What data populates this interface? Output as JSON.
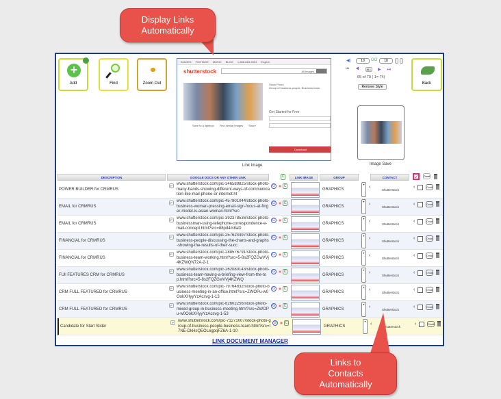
{
  "callouts": {
    "top": "Display Links Automatically",
    "bottom": "Links to Contacts Automatically"
  },
  "toolbar": {
    "add": "Add",
    "find": "Find",
    "zoom_out": "Zoom Out",
    "back": "Back"
  },
  "preview": {
    "tabs": [
      "IMAGES",
      "FOOTAGE",
      "MUSIC",
      "BLOG",
      "1-866-663-3954",
      "English"
    ],
    "logo": "shutterstock",
    "search_filter": "All images",
    "stock_photo": "Stock Photo",
    "description": "Group of business people. Business team.",
    "get_started": "Get Started for Free",
    "download": "Download",
    "actions": [
      "Save to a lightbox",
      "Find similar images",
      "Share"
    ],
    "caption": "Link Image"
  },
  "pager": {
    "per_page_1": "10",
    "per_page_2": "10",
    "all": "ALL",
    "status": "65 of 70 ( 1= 74)",
    "remove_style": "Remove Style"
  },
  "image_save": {
    "caption": "Image Save"
  },
  "table": {
    "headers": {
      "description": "DESCRIPTION",
      "link": "GOOGLE DOCS OR ANY OTHER LINK",
      "image": "LINK IMAGE",
      "group": "GROUP",
      "contact": "CONTACT"
    },
    "omail": "Omail",
    "rows": [
      {
        "description": "POWER BUILDER for CRMRUS",
        "link": "www.shutterstock.com/pic-346589825/stock-photo-many-hands-showing-different-ways-of-communication-like-mail-phone-or-internet.ht",
        "group": "GRAPHICS",
        "contact": "Shutterstock"
      },
      {
        "description": "EMAIL for CRMRUS",
        "link": "www.shutterstock.com/pic-457901044/stock-photo-business-woman-pressing-email-sign-focus-at-finger-model-is-asian-woman.html?src",
        "group": "GRAPHICS",
        "contact": "Shutterstock"
      },
      {
        "description": "EMAIL for CRMRUS",
        "link": "www.shutterstock.com/pic-392378536/stock-photo-businessman-using-telephone-correspondence-e-mail-concept.html?src=88pd4m8aD",
        "group": "GRAPHICS",
        "contact": "Shutterstock"
      },
      {
        "description": "FINANCIAL for CRMRUS",
        "link": "www.shutterstock.com/pic-257624497/stock-photo-business-people-discussing-the-charts-and-graphs-showing-the-results-of-their-succ",
        "group": "GRAPHICS",
        "contact": "Shutterstock"
      },
      {
        "description": "FINANCIAL for CRMRUS",
        "link": "www.shutterstock.com/pic-288576791/stock-photo-business-team-working.html?src=5-8s2FQZGwVVj4KZWQN72A-2-1",
        "group": "GRAPHICS",
        "contact": "Shutterstock"
      },
      {
        "description": "FUll FEATURES  CRM for CRMRUS",
        "link": "www.shutterstock.com/pic-262080143/stock-photo-business-team-having-a-briefing-view-from-the-top.html?src=5-8s2FQZGwVVj4KZWQ",
        "group": "GRAPHICS",
        "contact": "Shutterstock"
      },
      {
        "description": "CRM FULL FEATURED for CRMRUS",
        "link": "www.shutterstock.com/pic-79764832/stock-photo-business-meeting-in-an-office.html?src=ZWOPu-w0OokXHyyYzAcsvg-1-13",
        "group": "GRAPHICS",
        "contact": "Shutterstock"
      },
      {
        "description": "CRM FULL FEATURED for CRMRUS",
        "link": "www.shutterstock.com/pic-82602256/stock-photo-mixed-group-in-business-meeting.html?src=ZWOPu-w0OokXHyyYzAcsvg-1-53",
        "group": "GRAPHICS",
        "contact": "Shutterstock"
      },
      {
        "description": "Candidate for Start Slider",
        "link": "www.shutterstock.com/pic-71271007/stock-photo-group-of-business-people-business-team.html?src=I7NE-DkHsQEOLegpqFZ6A-1-10",
        "group": "GRAPHICS",
        "contact": "Shutterstock",
        "highlighted": true
      }
    ]
  },
  "footer": "LINK DOCUMENT MANAGER",
  "colors": {
    "callout": "#e8524a",
    "panel_border": "#1f3d7a",
    "header_text": "#1a3aa0",
    "highlight_row": "#fcfad6"
  }
}
